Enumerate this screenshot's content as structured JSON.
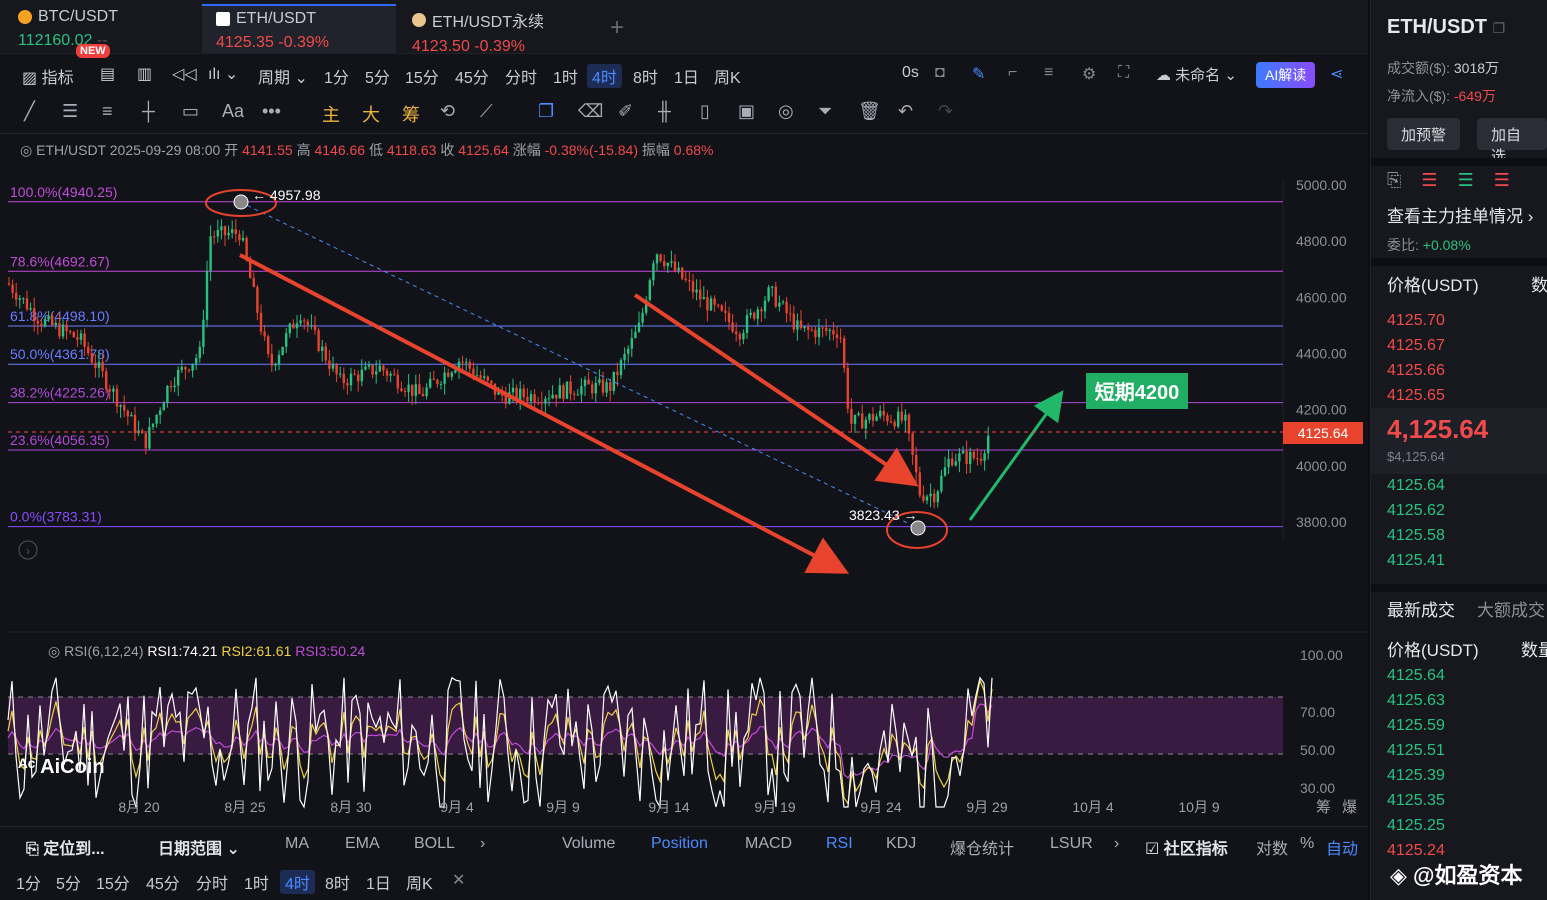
{
  "tabs": [
    {
      "name": "BTC/USDT",
      "price": "112160.02",
      "change": "--",
      "badge": "NEW"
    },
    {
      "name": "ETH/USDT",
      "price": "4125.35",
      "change": "-0.39%"
    },
    {
      "name": "ETH/USDT永续",
      "price": "4123.50",
      "change": "-0.39%"
    }
  ],
  "toolbar": {
    "indicator": "指标",
    "period": "周期",
    "intervals": [
      "1分",
      "5分",
      "15分",
      "45分",
      "分时",
      "1时",
      "4时",
      "8时",
      "1日",
      "周K"
    ],
    "active_interval": "4时",
    "countdown": "0s",
    "layout_name": "未命名",
    "ai_label": "AI解读"
  },
  "draw_tools": {
    "main": "主",
    "big": "大",
    "chip": "筹",
    "text": "Aa"
  },
  "ohlc": {
    "symbol": "ETH/USDT",
    "datetime": "2025-09-29 08:00",
    "open_label": "开",
    "open": "4141.55",
    "high_label": "高",
    "high": "4146.66",
    "low_label": "低",
    "low": "4118.63",
    "close_label": "收",
    "close": "4125.64",
    "change_label": "涨幅",
    "change": "-0.38%(-15.84)",
    "amp_label": "振幅",
    "amp": "0.68%"
  },
  "fib": [
    {
      "label": "100.0%(4940.25)",
      "value": 4940.25,
      "color": "#c24bd9"
    },
    {
      "label": "78.6%(4692.67)",
      "value": 4692.67,
      "color": "#c24bd9"
    },
    {
      "label": "61.8%(4498.10)",
      "value": 4498.1,
      "color": "#6a7dff"
    },
    {
      "label": "50.0%(4361.78)",
      "value": 4361.78,
      "color": "#6a7dff"
    },
    {
      "label": "38.2%(4225.26)",
      "value": 4225.26,
      "color": "#b04ad8"
    },
    {
      "label": "23.6%(4056.35)",
      "value": 4056.35,
      "color": "#b04ad8"
    },
    {
      "label": "0.0%(3783.31)",
      "value": 3783.31,
      "color": "#8a4bff"
    }
  ],
  "annotations": {
    "high_marker": "4957.98",
    "low_marker": "3823.43",
    "target": "短期4200",
    "current_price": "4125.64"
  },
  "price_axis": [
    "5000.00",
    "4800.00",
    "4600.00",
    "4400.00",
    "4200.00",
    "4000.00",
    "3800.00"
  ],
  "date_axis": [
    "8月 20",
    "8月 25",
    "8月 30",
    "9月 4",
    "9月 9",
    "9月 14",
    "9月 19",
    "9月 24",
    "9月 29",
    "10月 4",
    "10月 9"
  ],
  "date_axis_right": [
    "筹",
    "爆"
  ],
  "rsi": {
    "name": "RSI(6,12,24)",
    "rsi1": "RSI1:74.21",
    "rsi2": "RSI2:61.61",
    "rsi3": "RSI3:50.24",
    "axis": [
      "100.00",
      "70.00",
      "50.00",
      "30.00"
    ],
    "brand": "AiCoin"
  },
  "bottom_bar": {
    "locate": "定位到...",
    "date_range": "日期范围",
    "indicators_main": [
      "MA",
      "EMA",
      "BOLL"
    ],
    "indicators_sub": [
      "Volume",
      "Position",
      "MACD",
      "RSI",
      "KDJ",
      "爆仓统计",
      "LSUR"
    ],
    "community": "社区指标",
    "log": "对数",
    "percent": "%",
    "auto": "自动",
    "intervals": [
      "1分",
      "5分",
      "15分",
      "45分",
      "分时",
      "1时",
      "4时",
      "8时",
      "1日",
      "周K"
    ],
    "active_interval": "4时"
  },
  "side": {
    "title": "ETH/USDT",
    "turnover_label": "成交额($):",
    "turnover": "3018万",
    "netflow_label": "净流入($):",
    "netflow": "-649万",
    "btn_alert": "加预警",
    "btn_fav": "加自选",
    "depth_link": "查看主力挂单情况",
    "ratio_label": "委比:",
    "ratio": "+0.08%",
    "ob_header_price": "价格(USDT)",
    "ob_header_qty": "数",
    "asks": [
      "4125.70",
      "4125.67",
      "4125.66",
      "4125.65"
    ],
    "mid_price": "4,125.64",
    "mid_usd": "$4,125.64",
    "bids": [
      "4125.64",
      "4125.62",
      "4125.58",
      "4125.41"
    ],
    "trades_tab": "最新成交",
    "big_trades_tab": "大额成交",
    "trades_header_price": "价格(USDT)",
    "trades_header_qty": "数量",
    "trades": [
      "4125.64",
      "4125.63",
      "4125.59",
      "4125.51",
      "4125.39",
      "4125.35",
      "4125.25",
      "4125.24"
    ],
    "watermark": "@如盈资本"
  }
}
